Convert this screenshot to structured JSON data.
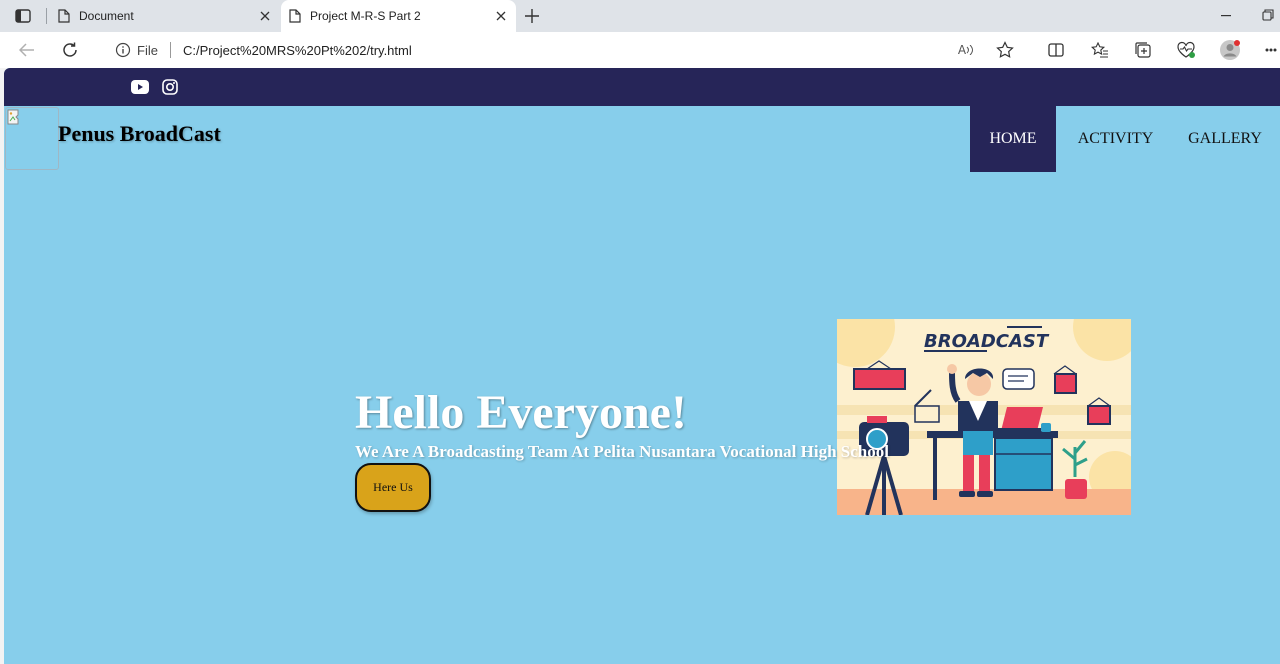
{
  "browser": {
    "tabs": [
      {
        "title": "Document",
        "active": false
      },
      {
        "title": "Project M-R-S Part 2",
        "active": true
      }
    ],
    "address": {
      "scheme_label": "File",
      "url": "C:/Project%20MRS%20Pt%202/try.html"
    },
    "read_aloud_label": "A",
    "icons": {
      "back": "arrow-left-icon",
      "refresh": "refresh-icon",
      "info": "info-icon",
      "favorite": "star-icon",
      "split": "split-screen-icon",
      "favorites": "favorites-list-icon",
      "collections": "collections-icon",
      "health": "browser-essentials-icon",
      "profile": "profile-avatar-icon",
      "more": "more-icon"
    }
  },
  "site": {
    "social": [
      {
        "name": "youtube-icon"
      },
      {
        "name": "instagram-icon"
      }
    ],
    "brand": "Penus BroadCast",
    "nav": [
      "HOME",
      "ACTIVITY",
      "GALLERY"
    ],
    "active_nav": "HOME",
    "hero": {
      "title": "Hello Everyone!",
      "subtitle": "We Are A Broadcasting Team At Pelita Nusantara Vocational High School",
      "button": "Here Us"
    },
    "illustration": {
      "heading": "BROADCAST"
    }
  },
  "colors": {
    "page_bg": "#87ceeb",
    "header_strip": "#262558",
    "button": "#d9a31a",
    "illustration_bg": "#fdf0cf"
  }
}
